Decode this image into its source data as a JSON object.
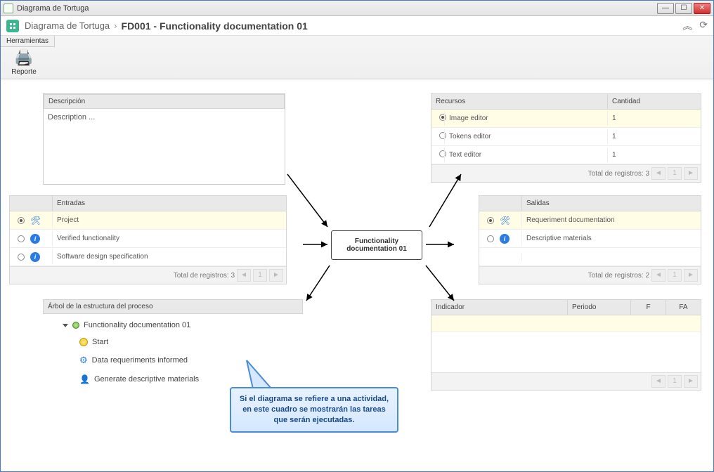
{
  "window_title": "Diagrama de Tortuga",
  "breadcrumb": {
    "root": "Diagrama de Tortuga",
    "current": "FD001 - Functionality documentation 01"
  },
  "ribbon": {
    "tab": "Herramientas",
    "report": "Reporte"
  },
  "descripcion": {
    "header": "Descripción",
    "body": "Description ..."
  },
  "recursos": {
    "headers": {
      "name": "Recursos",
      "qty": "Cantidad"
    },
    "rows": [
      {
        "name": "Image editor",
        "qty": "1",
        "selected": true
      },
      {
        "name": "Tokens editor",
        "qty": "1",
        "selected": false
      },
      {
        "name": "Text editor",
        "qty": "1",
        "selected": false
      }
    ],
    "footer": "Total de registros: 3"
  },
  "entradas": {
    "header": "Entradas",
    "rows": [
      {
        "name": "Project",
        "icon": "wrench",
        "selected": true
      },
      {
        "name": "Verified functionality",
        "icon": "info",
        "selected": false
      },
      {
        "name": "Software design specification",
        "icon": "info",
        "selected": false
      }
    ],
    "footer": "Total de registros: 3"
  },
  "salidas": {
    "header": "Salidas",
    "rows": [
      {
        "name": "Requeriment documentation",
        "icon": "wrench",
        "selected": true
      },
      {
        "name": "Descriptive materials",
        "icon": "info",
        "selected": false
      }
    ],
    "footer": "Total de registros: 2"
  },
  "indicador": {
    "headers": {
      "c0": "Indicador",
      "c1": "Periodo",
      "c2": "F",
      "c3": "FA"
    }
  },
  "tree": {
    "header": "Árbol de la estructura del proceso",
    "root": "Functionality documentation 01",
    "items": [
      {
        "label": "Start",
        "icon": "yellow-circle"
      },
      {
        "label": "Data requeriments informed",
        "icon": "gear"
      },
      {
        "label": "Generate descriptive materials",
        "icon": "person"
      }
    ]
  },
  "center_node": "Functionality documentation 01",
  "callout": "Si el diagrama se refiere a una actividad, en este cuadro se mostrarán las tareas que serán ejecutadas.",
  "page_number": "1"
}
